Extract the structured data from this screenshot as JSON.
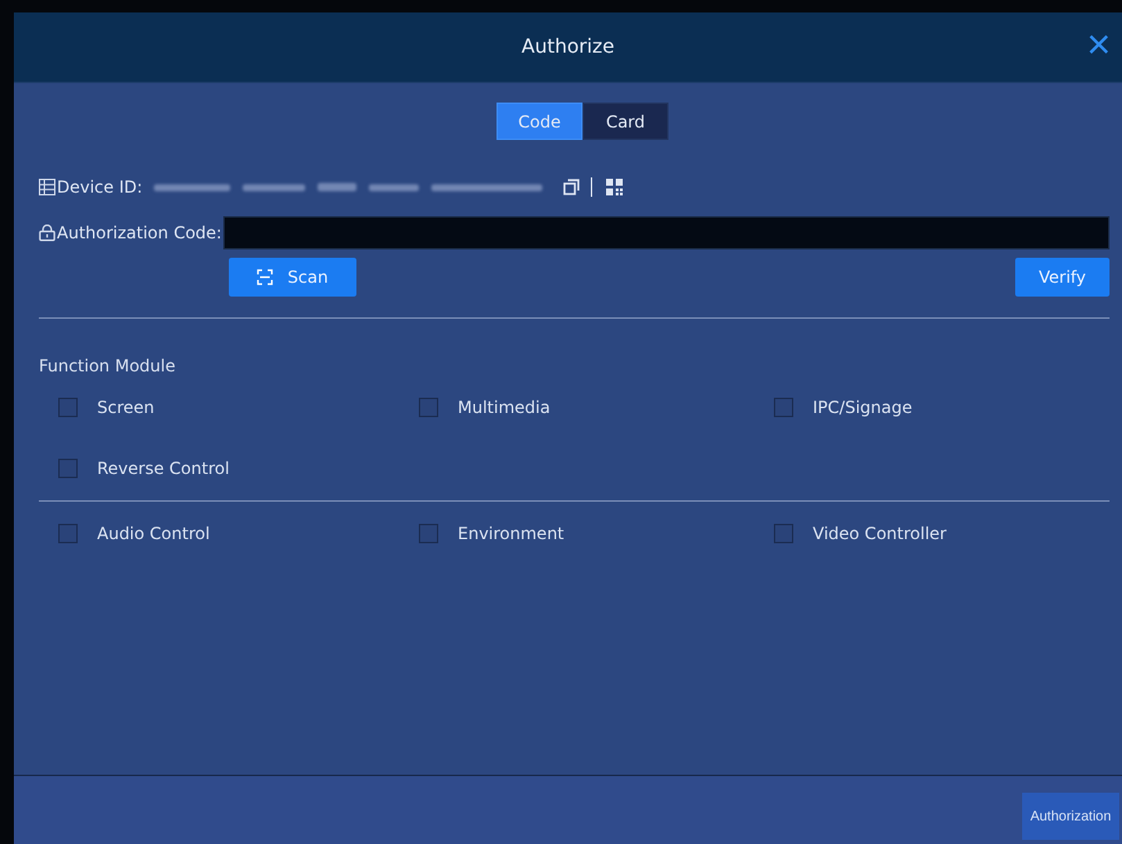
{
  "window": {
    "title": "Authorize",
    "close": "×"
  },
  "tabs": [
    {
      "label": "Code",
      "selected": true
    },
    {
      "label": "Card",
      "selected": false
    }
  ],
  "device_id": {
    "label": "Device ID:"
  },
  "authorization_code": {
    "label": "Authorization Code:"
  },
  "buttons": {
    "scan": "Scan",
    "verify": "Verify"
  },
  "function_module": {
    "title": "Function Module",
    "groups": [
      [
        {
          "label": "Screen",
          "checked": false
        },
        {
          "label": "Multimedia",
          "checked": false
        },
        {
          "label": "IPC/Signage",
          "checked": false
        },
        {
          "label": "Reverse Control",
          "checked": false
        }
      ],
      [
        {
          "label": "Audio Control",
          "checked": false
        },
        {
          "label": "Environment",
          "checked": false
        },
        {
          "label": "Video Controller",
          "checked": false
        }
      ]
    ]
  },
  "footer": {
    "button": "Authorization"
  }
}
